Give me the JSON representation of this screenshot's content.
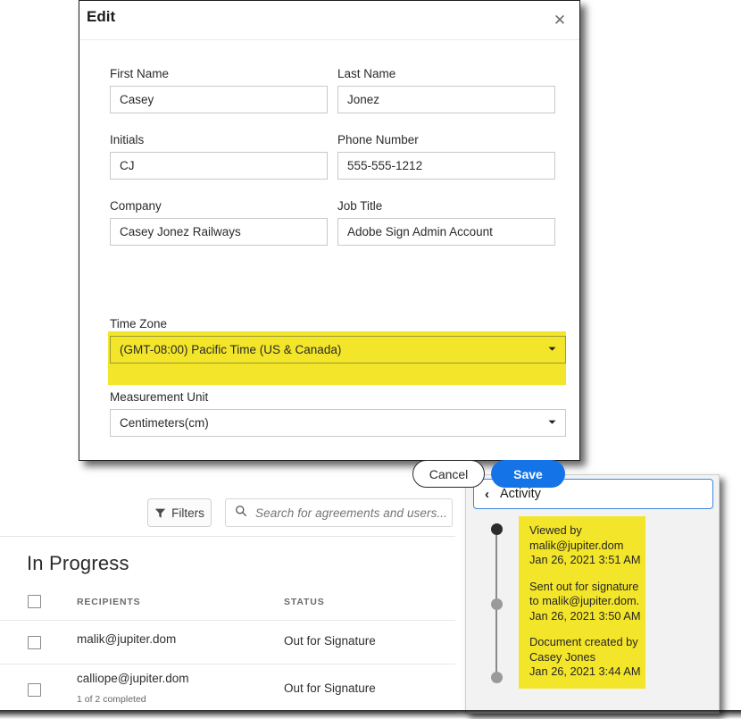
{
  "modal": {
    "title": "Edit",
    "close_icon": "close-icon",
    "fields": [
      {
        "label": "First Name",
        "value": "Casey"
      },
      {
        "label": "Last Name",
        "value": "Jonez"
      },
      {
        "label": "Initials",
        "value": "CJ"
      },
      {
        "label": "Phone Number",
        "value": "555-555-1212"
      },
      {
        "label": "Company",
        "value": "Casey Jonez Railways"
      },
      {
        "label": "Job Title",
        "value": "Adobe Sign Admin Account"
      }
    ],
    "timezone": {
      "label": "Time Zone",
      "value": "(GMT-08:00) Pacific Time (US & Canada)",
      "highlight_color": "#f3e529"
    },
    "measurement_unit": {
      "label": "Measurement Unit",
      "value": "Centimeters(cm)"
    },
    "cancel_label": "Cancel",
    "save_label": "Save",
    "save_color": "#1473e6"
  },
  "toolbar": {
    "filters_label": "Filters",
    "filters_icon": "funnel-icon",
    "search_icon": "search-icon",
    "search_placeholder": "Search for agreements and users..."
  },
  "list": {
    "section_title": "In Progress",
    "columns": [
      "RECIPIENTS",
      "STATUS"
    ],
    "rows": [
      {
        "recipient": "malik@jupiter.dom",
        "sub": "",
        "status": "Out for Signature"
      },
      {
        "recipient": "calliope@jupiter.dom",
        "sub": "1 of 2 completed",
        "status": "Out for Signature"
      }
    ]
  },
  "activity": {
    "back_icon": "chevron-left-icon",
    "title": "Activity",
    "highlight_color": "#f3e529",
    "entries": [
      {
        "text": "Viewed by malik@jupiter.dom",
        "timestamp": "Jan 26, 2021 3:51 AM",
        "dot": "dark"
      },
      {
        "text": "Sent out for signature to malik@jupiter.dom.",
        "timestamp": "Jan 26, 2021 3:50 AM",
        "dot": "grey"
      },
      {
        "text": "Document created by Casey Jones",
        "timestamp": "Jan 26, 2021 3:44 AM",
        "dot": "grey"
      }
    ]
  }
}
